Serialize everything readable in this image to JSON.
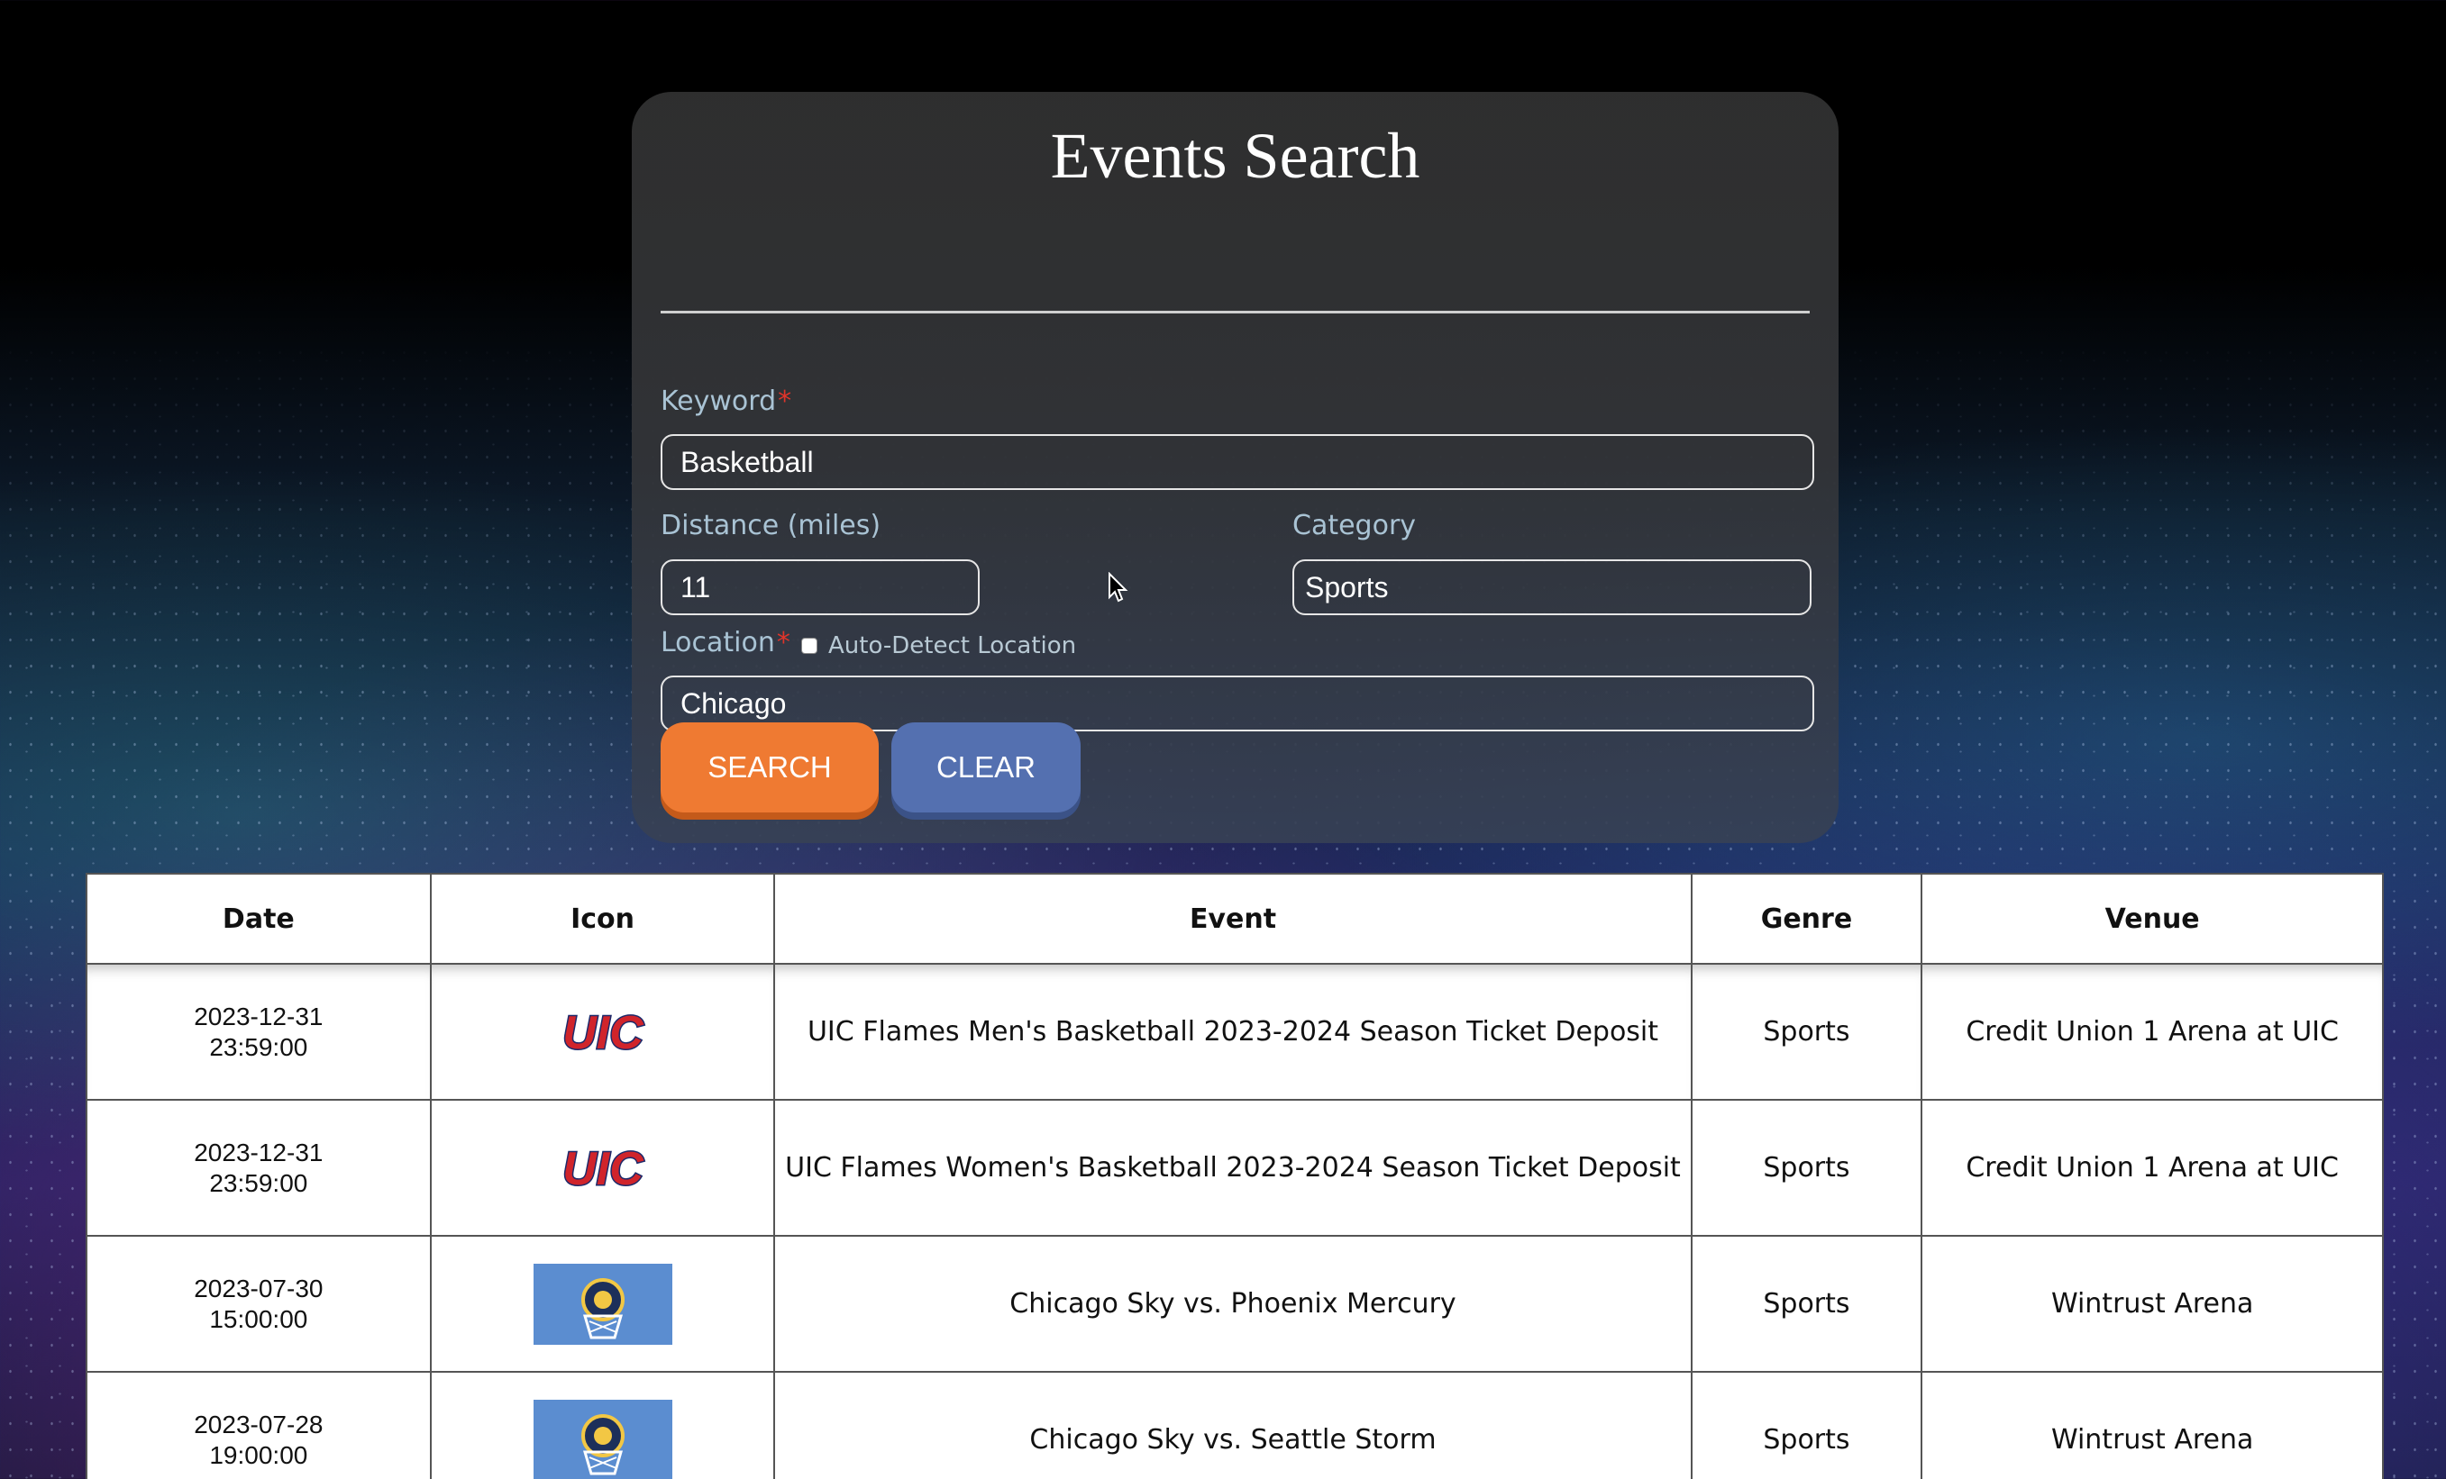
{
  "form": {
    "title": "Events Search",
    "keyword": {
      "label": "Keyword",
      "required_mark": "*",
      "value": "Basketball"
    },
    "distance": {
      "label": "Distance (miles)",
      "value": "11"
    },
    "category": {
      "label": "Category",
      "value": "Sports"
    },
    "location": {
      "label": "Location",
      "required_mark": "*",
      "value": "Chicago",
      "auto_detect_label": "Auto-Detect Location",
      "auto_detect_checked": false
    },
    "buttons": {
      "search": "SEARCH",
      "clear": "CLEAR"
    }
  },
  "table": {
    "headers": [
      "Date",
      "Icon",
      "Event",
      "Genre",
      "Venue"
    ],
    "rows": [
      {
        "date": "2023-12-31",
        "time": "23:59:00",
        "icon": "uic-flames-logo",
        "event": "UIC Flames Men's Basketball 2023-2024 Season Ticket Deposit",
        "genre": "Sports",
        "venue": "Credit Union 1 Arena at UIC"
      },
      {
        "date": "2023-12-31",
        "time": "23:59:00",
        "icon": "uic-flames-logo",
        "event": "UIC Flames Women's Basketball 2023-2024 Season Ticket Deposit",
        "genre": "Sports",
        "venue": "Credit Union 1 Arena at UIC"
      },
      {
        "date": "2023-07-30",
        "time": "15:00:00",
        "icon": "chicago-sky-logo",
        "event": "Chicago Sky vs. Phoenix Mercury",
        "genre": "Sports",
        "venue": "Wintrust Arena"
      },
      {
        "date": "2023-07-28",
        "time": "19:00:00",
        "icon": "chicago-sky-logo",
        "event": "Chicago Sky vs. Seattle Storm",
        "genre": "Sports",
        "venue": "Wintrust Arena"
      }
    ]
  },
  "colors": {
    "search_button": "#ef7a32",
    "clear_button": "#5470b0",
    "label": "#a9c3d4",
    "required": "#e0342a",
    "uic_red": "#d0242b",
    "uic_navy": "#1c2a6b",
    "sky_blue": "#5b8dd0"
  }
}
